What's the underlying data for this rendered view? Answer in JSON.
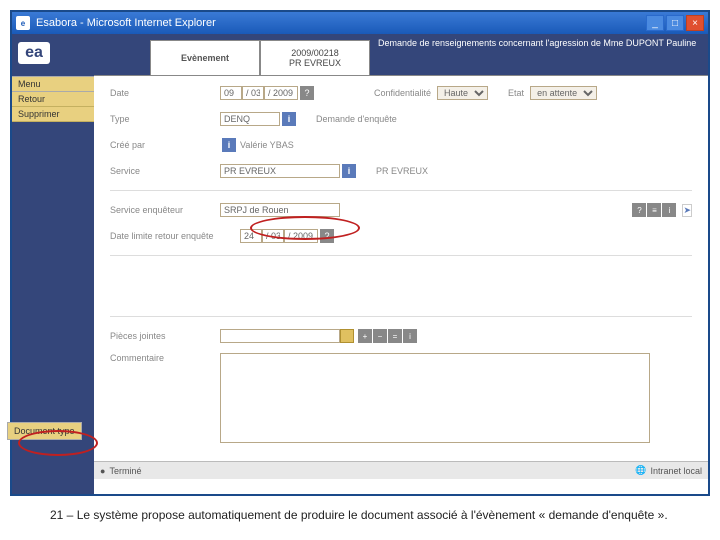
{
  "window": {
    "title": "Esabora - Microsoft Internet Explorer",
    "min": "_",
    "max": "□",
    "close": "×",
    "logo": "ea"
  },
  "sidebar": {
    "menu_label": "Menu",
    "items": [
      "Retour",
      "Supprimer"
    ],
    "doctype_label": "Document type"
  },
  "tabs": {
    "tab1": "Evènement",
    "tab2_ref": "2009/00218",
    "tab2_sub": "PR EVREUX",
    "desc": "Demande de renseignements concernant l'agression de Mme DUPONT Pauline"
  },
  "form": {
    "date_label": "Date",
    "date_d": "09",
    "date_m": "/ 03",
    "date_y": "/ 2009",
    "conf_label": "Confidentialité",
    "conf_value": "Haute",
    "etat_label": "Etat",
    "etat_value": "en attente",
    "type_label": "Type",
    "type_value": "DENQ",
    "type_desc": "Demande d'enquête",
    "createdby_label": "Créé par",
    "createdby_value": "Valérie YBAS",
    "service_label": "Service",
    "service_value": "PR EVREUX",
    "service_desc": "PR EVREUX",
    "service_enq_label": "Service enquêteur",
    "service_enq_value": "SRPJ de Rouen",
    "date_limit_label": "Date limite retour enquête",
    "date_limit_d": "24",
    "date_limit_m": "/ 03",
    "date_limit_y": "/ 2009",
    "pieces_label": "Pièces jointes",
    "comment_label": "Commentaire"
  },
  "icons": {
    "help": "?",
    "info": "i",
    "plus": "+",
    "minus": "−",
    "eq": "=",
    "list": "≡"
  },
  "status": {
    "done": "Terminé",
    "zone": "Intranet local"
  },
  "caption": "21 – Le système propose automatiquement de produire le document associé à l'évènement « demande d'enquête »."
}
